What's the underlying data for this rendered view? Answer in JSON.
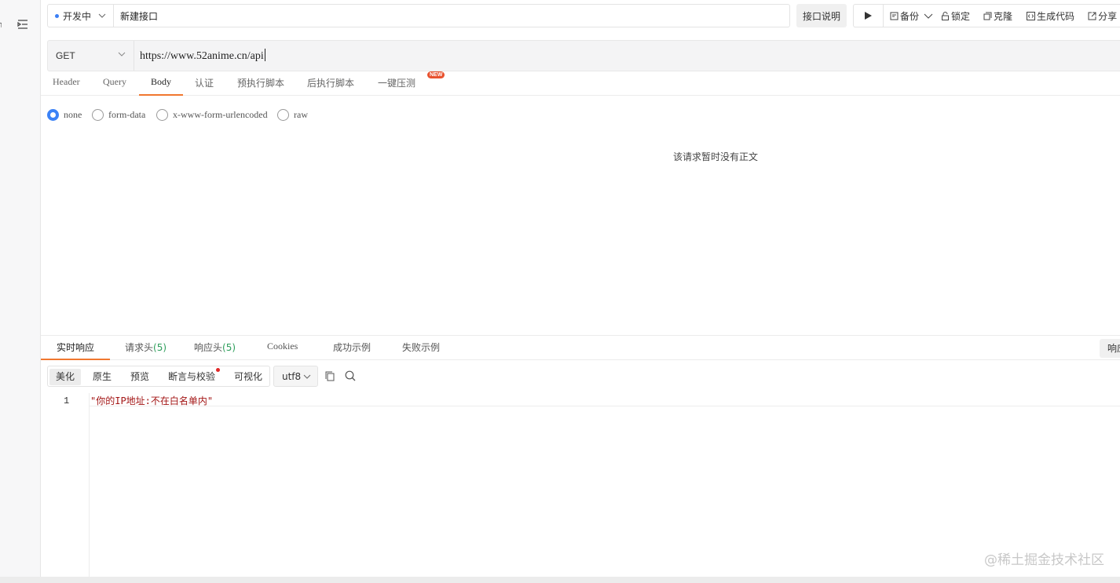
{
  "sidebar": {
    "mini_text": "ו"
  },
  "topbar": {
    "env_label": "开发中",
    "api_name": "新建接口",
    "doc_button": "接口说明",
    "actions": {
      "backup": "备份",
      "lock": "锁定",
      "clone": "克隆",
      "gen_code": "生成代码",
      "share": "分享"
    }
  },
  "request": {
    "method": "GET",
    "url": "https://www.52anime.cn/api"
  },
  "request_tabs": [
    "Header",
    "Query",
    "Body",
    "认证",
    "预执行脚本",
    "后执行脚本",
    "一键压测"
  ],
  "active_request_tab": "Body",
  "new_badge": "NEW",
  "body_types": [
    "none",
    "form-data",
    "x-www-form-urlencoded",
    "raw"
  ],
  "selected_body_type": "none",
  "empty_body_message": "该请求暂时没有正文",
  "response_tabs": {
    "realtime": "实时响应",
    "req_headers": "请求头",
    "req_headers_count": "(5)",
    "resp_headers": "响应头",
    "resp_headers_count": "(5)",
    "cookies": "Cookies",
    "success_example": "成功示例",
    "fail_example": "失败示例",
    "right_button": "响应"
  },
  "view_modes": [
    "美化",
    "原生",
    "预览",
    "断言与校验",
    "可视化"
  ],
  "active_view_mode": "美化",
  "encoding": "utf8",
  "response_body": {
    "line_number": "1",
    "text": "\"你的IP地址:不在白名单内\""
  },
  "watermark": "@稀土掘金技术社区",
  "colors": {
    "accent": "#f0772f",
    "radio": "#3b82f6",
    "count_green": "#2e9e5b",
    "code_string": "#a31515",
    "badge_red": "#e8522f"
  }
}
